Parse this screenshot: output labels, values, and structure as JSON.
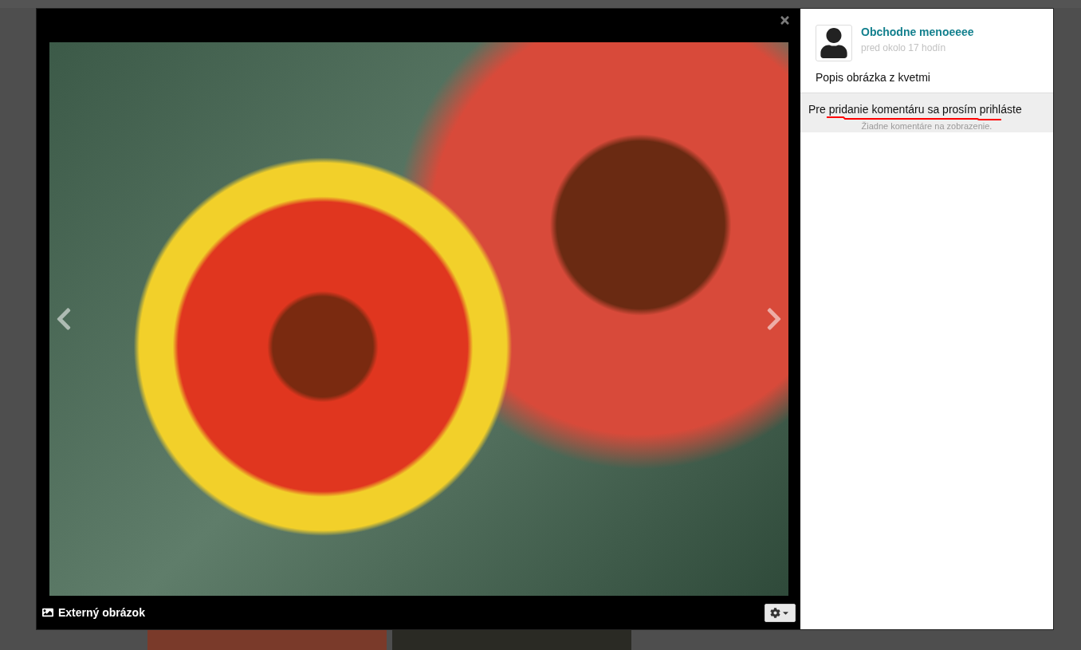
{
  "lightbox": {
    "caption": "Externý obrázok"
  },
  "sidebar": {
    "author": "Obchodne menoeeee",
    "time": "pred okolo 17 hodín",
    "description": "Popis obrázka z kvetmi",
    "login_prompt": "Pre pridanie komentáru sa prosím prihláste",
    "no_comments": "Žiadne komentáre na zobrazenie."
  }
}
